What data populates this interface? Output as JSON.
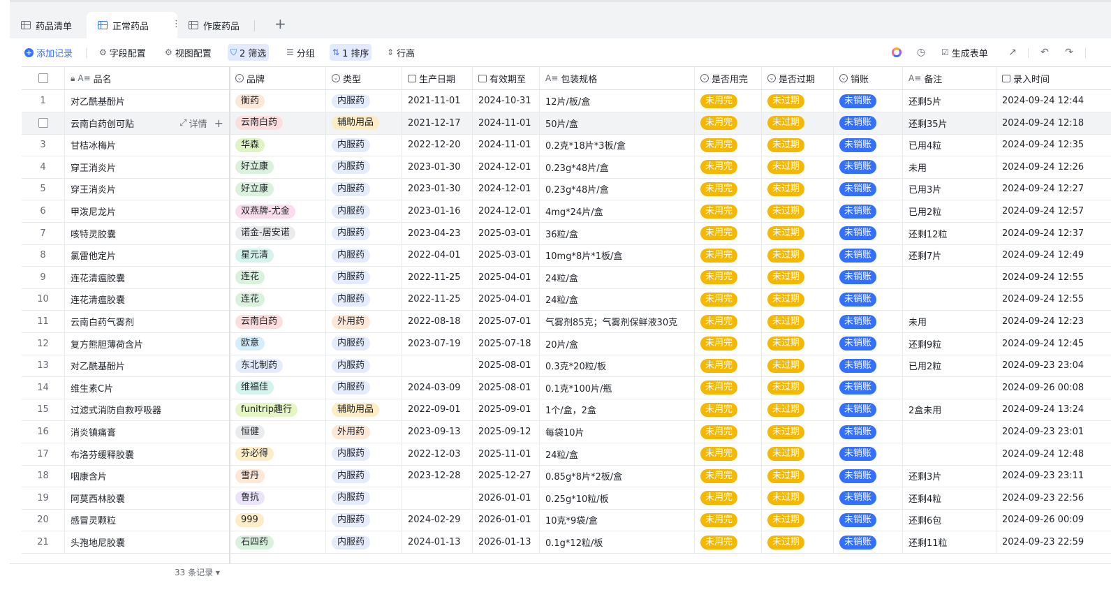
{
  "tabs": [
    {
      "label": "药品清单",
      "active": false
    },
    {
      "label": "正常药品",
      "active": true
    },
    {
      "label": "作废药品",
      "active": false
    }
  ],
  "toolbar": {
    "add_record": "添加记录",
    "field_config": "字段配置",
    "view_config": "视图配置",
    "filter": "2 筛选",
    "group": "分组",
    "sort": "1 排序",
    "row_height": "行高",
    "generate_form": "生成表单"
  },
  "columns": [
    "品名",
    "品牌",
    "类型",
    "生产日期",
    "有效期至",
    "包装规格",
    "是否用完",
    "是否过期",
    "销账",
    "备注",
    "录入时间"
  ],
  "row_detail_label": "详情",
  "colors": {
    "accent": "#3370ff",
    "used_status": "#f5b800",
    "expired_status": "#f5b800",
    "writeoff_status": "#3370ff"
  },
  "rows": [
    {
      "n": "1",
      "name": "对乙酰基酚片",
      "brand": "衡药",
      "brand_color": "#fde7d6",
      "type": "内服药",
      "type_color": "#e4ecfb",
      "mfg": "2021-11-01",
      "exp": "2024-10-31",
      "pack": "12片/板/盒",
      "used": "未用完",
      "expired": "未过期",
      "writeoff": "未销账",
      "note": "还剩5片",
      "time": "2024-09-24  12:44"
    },
    {
      "n": "2",
      "name": "云南白药创可贴",
      "brand": "云南白药",
      "brand_color": "#fcdede",
      "type": "辅助用品",
      "type_color": "#fcedc6",
      "mfg": "2021-12-17",
      "exp": "2024-11-01",
      "pack": "50片/盒",
      "used": "未用完",
      "expired": "未过期",
      "writeoff": "未销账",
      "note": "还剩35片",
      "time": "2024-09-24  12:18"
    },
    {
      "n": "3",
      "name": "甘桔冰梅片",
      "brand": "华森",
      "brand_color": "#dff3c4",
      "type": "内服药",
      "type_color": "#e4ecfb",
      "mfg": "2022-12-20",
      "exp": "2024-11-01",
      "pack": "0.2克*18片*3板/盒",
      "used": "未用完",
      "expired": "未过期",
      "writeoff": "未销账",
      "note": "已用4粒",
      "time": "2024-09-24  12:35"
    },
    {
      "n": "4",
      "name": "穿王消炎片",
      "brand": "好立康",
      "brand_color": "#d9f1dd",
      "type": "内服药",
      "type_color": "#e4ecfb",
      "mfg": "2023-01-30",
      "exp": "2024-12-01",
      "pack": "0.23g*48片/盒",
      "used": "未用完",
      "expired": "未过期",
      "writeoff": "未销账",
      "note": "未用",
      "time": "2024-09-24  12:26"
    },
    {
      "n": "5",
      "name": "穿王消炎片",
      "brand": "好立康",
      "brand_color": "#d9f1dd",
      "type": "内服药",
      "type_color": "#e4ecfb",
      "mfg": "2023-01-30",
      "exp": "2024-12-01",
      "pack": "0.23g*48片/盒",
      "used": "未用完",
      "expired": "未过期",
      "writeoff": "未销账",
      "note": "已用3片",
      "time": "2024-09-24  12:27"
    },
    {
      "n": "6",
      "name": "甲泼尼龙片",
      "brand": "双燕牌-尤金",
      "brand_color": "#fbdcec",
      "type": "内服药",
      "type_color": "#e4ecfb",
      "mfg": "2023-01-16",
      "exp": "2024-12-01",
      "pack": "4mg*24片/盒",
      "used": "未用完",
      "expired": "未过期",
      "writeoff": "未销账",
      "note": "已用2粒",
      "time": "2024-09-24  12:57"
    },
    {
      "n": "7",
      "name": "咳特灵胶囊",
      "brand": "诺金-居安诺",
      "brand_color": "#eaebed",
      "type": "内服药",
      "type_color": "#e4ecfb",
      "mfg": "2023-04-23",
      "exp": "2025-03-01",
      "pack": "36粒/盒",
      "used": "未用完",
      "expired": "未过期",
      "writeoff": "未销账",
      "note": "还剩12粒",
      "time": "2024-09-24  12:37"
    },
    {
      "n": "8",
      "name": "氯雷他定片",
      "brand": "星元清",
      "brand_color": "#d3f3ec",
      "type": "内服药",
      "type_color": "#e4ecfb",
      "mfg": "2022-04-01",
      "exp": "2025-03-01",
      "pack": "10mg*8片*1板/盒",
      "used": "未用完",
      "expired": "未过期",
      "writeoff": "未销账",
      "note": "还剩7片",
      "time": "2024-09-24  12:49"
    },
    {
      "n": "9",
      "name": "连花清瘟胶囊",
      "brand": "连花",
      "brand_color": "#d9f1dd",
      "type": "内服药",
      "type_color": "#e4ecfb",
      "mfg": "2022-11-25",
      "exp": "2025-04-01",
      "pack": "24粒/盒",
      "used": "未用完",
      "expired": "未过期",
      "writeoff": "未销账",
      "note": "",
      "time": "2024-09-24  12:55"
    },
    {
      "n": "10",
      "name": "连花清瘟胶囊",
      "brand": "连花",
      "brand_color": "#d9f1dd",
      "type": "内服药",
      "type_color": "#e4ecfb",
      "mfg": "2022-11-25",
      "exp": "2025-04-01",
      "pack": "24粒/盒",
      "used": "未用完",
      "expired": "未过期",
      "writeoff": "未销账",
      "note": "",
      "time": "2024-09-24  12:55"
    },
    {
      "n": "11",
      "name": "云南白药气雾剂",
      "brand": "云南白药",
      "brand_color": "#fcdede",
      "type": "外用药",
      "type_color": "#fde7d6",
      "mfg": "2022-08-18",
      "exp": "2025-07-01",
      "pack": "气雾剂85克；气雾剂保鲜液30克",
      "used": "未用完",
      "expired": "未过期",
      "writeoff": "未销账",
      "note": "未用",
      "time": "2024-09-24  12:23"
    },
    {
      "n": "12",
      "name": "复方熊胆薄荷含片",
      "brand": "欧意",
      "brand_color": "#d4eefb",
      "type": "内服药",
      "type_color": "#e4ecfb",
      "mfg": "2023-07-19",
      "exp": "2025-07-18",
      "pack": "20片/盒",
      "used": "未用完",
      "expired": "未过期",
      "writeoff": "未销账",
      "note": "还剩9粒",
      "time": "2024-09-24  12:45"
    },
    {
      "n": "13",
      "name": "对乙酰基酚片",
      "brand": "东北制药",
      "brand_color": "#e4ecfb",
      "type": "内服药",
      "type_color": "#e4ecfb",
      "mfg": "",
      "exp": "2025-08-01",
      "pack": "0.3克*20粒/板",
      "used": "未用完",
      "expired": "未过期",
      "writeoff": "未销账",
      "note": "已用2粒",
      "time": "2024-09-23  23:04"
    },
    {
      "n": "14",
      "name": "维生素C片",
      "brand": "维福佳",
      "brand_color": "#d3f3ec",
      "type": "内服药",
      "type_color": "#e4ecfb",
      "mfg": "2024-03-09",
      "exp": "2025-08-01",
      "pack": "0.1克*100片/瓶",
      "used": "未用完",
      "expired": "未过期",
      "writeoff": "未销账",
      "note": "",
      "time": "2024-09-26  00:08"
    },
    {
      "n": "15",
      "name": "过滤式消防自救呼吸器",
      "brand": "funitrip趣行",
      "brand_color": "#e6f5c4",
      "type": "辅助用品",
      "type_color": "#fcedc6",
      "mfg": "2022-09-01",
      "exp": "2025-09-01",
      "pack": "1个/盒，2盒",
      "used": "未用完",
      "expired": "未过期",
      "writeoff": "未销账",
      "note": "2盒未用",
      "time": "2024-09-24  13:24"
    },
    {
      "n": "16",
      "name": "消炎镇痛膏",
      "brand": "恒健",
      "brand_color": "#eaebed",
      "type": "外用药",
      "type_color": "#fde7d6",
      "mfg": "2023-09-13",
      "exp": "2025-09-12",
      "pack": "每袋10片",
      "used": "未用完",
      "expired": "未过期",
      "writeoff": "未销账",
      "note": "",
      "time": "2024-09-23  23:01"
    },
    {
      "n": "17",
      "name": "布洛芬缓释胶囊",
      "brand": "芬必得",
      "brand_color": "#fcedc6",
      "type": "内服药",
      "type_color": "#e4ecfb",
      "mfg": "2022-12-03",
      "exp": "2025-11-01",
      "pack": "24粒/盒",
      "used": "未用完",
      "expired": "未过期",
      "writeoff": "未销账",
      "note": "",
      "time": "2024-09-24  12:48"
    },
    {
      "n": "18",
      "name": "咽康含片",
      "brand": "雪丹",
      "brand_color": "#fde7d6",
      "type": "内服药",
      "type_color": "#e4ecfb",
      "mfg": "2023-12-28",
      "exp": "2025-12-27",
      "pack": "0.85g*8片*2板/盒",
      "used": "未用完",
      "expired": "未过期",
      "writeoff": "未销账",
      "note": "还剩3片",
      "time": "2024-09-23  23:11"
    },
    {
      "n": "19",
      "name": "阿莫西林胶囊",
      "brand": "鲁抗",
      "brand_color": "#ebe2fb",
      "type": "内服药",
      "type_color": "#e4ecfb",
      "mfg": "",
      "exp": "2026-01-01",
      "pack": "0.25g*10粒/板",
      "used": "未用完",
      "expired": "未过期",
      "writeoff": "未销账",
      "note": "还剩4粒",
      "time": "2024-09-23  22:56"
    },
    {
      "n": "20",
      "name": "感冒灵颗粒",
      "brand": "999",
      "brand_color": "#fcedc6",
      "type": "内服药",
      "type_color": "#e4ecfb",
      "mfg": "2024-02-29",
      "exp": "2026-01-01",
      "pack": "10克*9袋/盒",
      "used": "未用完",
      "expired": "未过期",
      "writeoff": "未销账",
      "note": "还剩6包",
      "time": "2024-09-26  00:09"
    },
    {
      "n": "21",
      "name": "头孢地尼胶囊",
      "brand": "石四药",
      "brand_color": "#d9f1dd",
      "type": "内服药",
      "type_color": "#e4ecfb",
      "mfg": "2024-01-13",
      "exp": "2026-01-13",
      "pack": "0.1g*12粒/板",
      "used": "未用完",
      "expired": "未过期",
      "writeoff": "未销账",
      "note": "还剩11粒",
      "time": "2024-09-23  22:59"
    }
  ],
  "footer": {
    "record_count": "33 条记录 ▾"
  }
}
